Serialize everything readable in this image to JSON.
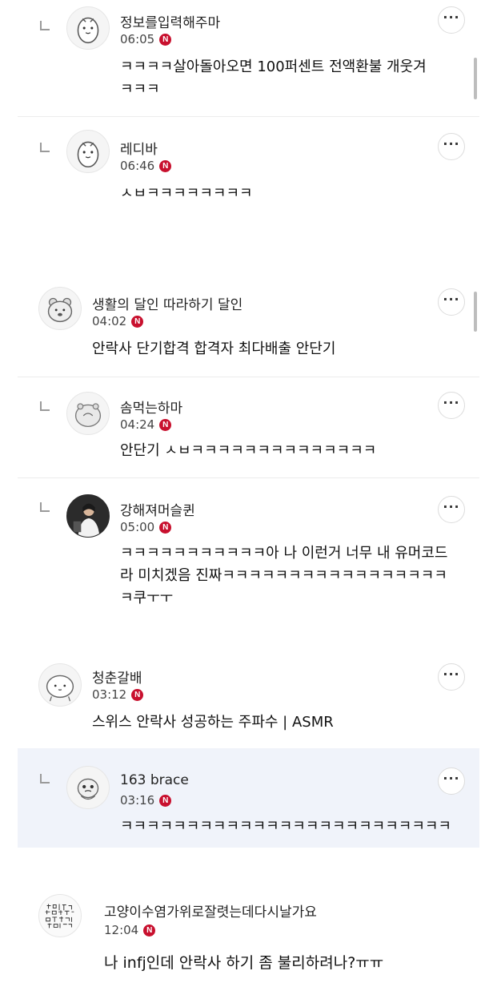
{
  "comments": [
    {
      "nickname": "정보를입력해주마",
      "time": "06:05",
      "badge": "N",
      "text": "ㅋㅋㅋㅋ살아돌아오면 100퍼센트 전액환불 개웃겨\nㅋㅋㅋ",
      "more": "···"
    },
    {
      "nickname": "레디바",
      "time": "06:46",
      "badge": "N",
      "text": "ㅅㅂㅋㅋㅋㅋㅋㅋㅋㅋ",
      "more": "···"
    },
    {
      "nickname": "생활의 달인 따라하기 달인",
      "time": "04:02",
      "badge": "N",
      "text": "안락사 단기합격 합격자 최다배출 안단기",
      "more": "···"
    },
    {
      "nickname": "솜먹는하마",
      "time": "04:24",
      "badge": "N",
      "text": "안단기 ㅅㅂㅋㅋㅋㅋㅋㅋㅋㅋㅋㅋㅋㅋㅋㅋ",
      "more": "···"
    },
    {
      "nickname": "강해져머슬퀸",
      "time": "05:00",
      "badge": "N",
      "text": "ㅋㅋㅋㅋㅋㅋㅋㅋㅋㅋㅋ아 나 이런거 너무 내 유머코드\n라 미치겠음 진짜ㅋㅋㅋㅋㅋㅋㅋㅋㅋㅋㅋㅋㅋㅋㅋㅋㅋ\nㅋ쿠ㅜㅜ",
      "more": "···"
    },
    {
      "nickname": "청춘갈배",
      "time": "03:12",
      "badge": "N",
      "text": "스위스 안락사 성공하는 주파수 | ASMR",
      "more": "···"
    },
    {
      "nickname": "163 brace",
      "time": "03:16",
      "badge": "N",
      "text": "ㅋㅋㅋㅋㅋㅋㅋㅋㅋㅋㅋㅋㅋㅋㅋㅋㅋㅋㅋㅋㅋㅋㅋㅋㅋ",
      "more": "···"
    },
    {
      "nickname": "고양이수염가위로잘렷는데다시날가요",
      "time": "12:04",
      "badge": "N",
      "text": "나 infj인데 안락사 하기 좀 불리하려나?ㅠㅠ",
      "more": "···"
    }
  ]
}
